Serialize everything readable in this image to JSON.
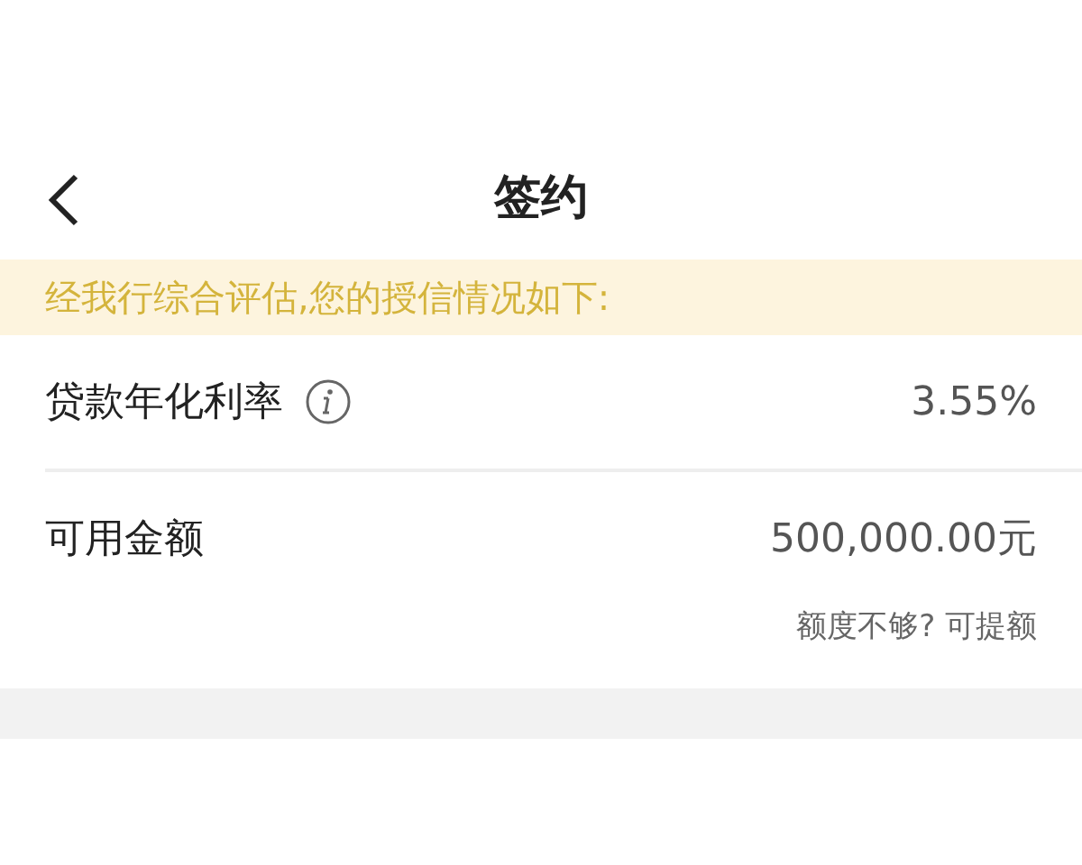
{
  "nav": {
    "title": "签约"
  },
  "notice": "经我行综合评估,您的授信情况如下:",
  "rows": [
    {
      "label": "贷款年化利率",
      "info": true,
      "value": "3.55%"
    },
    {
      "label": "可用金额",
      "info": false,
      "value": "500,000.00元"
    }
  ],
  "hint": "额度不够? 可提额"
}
